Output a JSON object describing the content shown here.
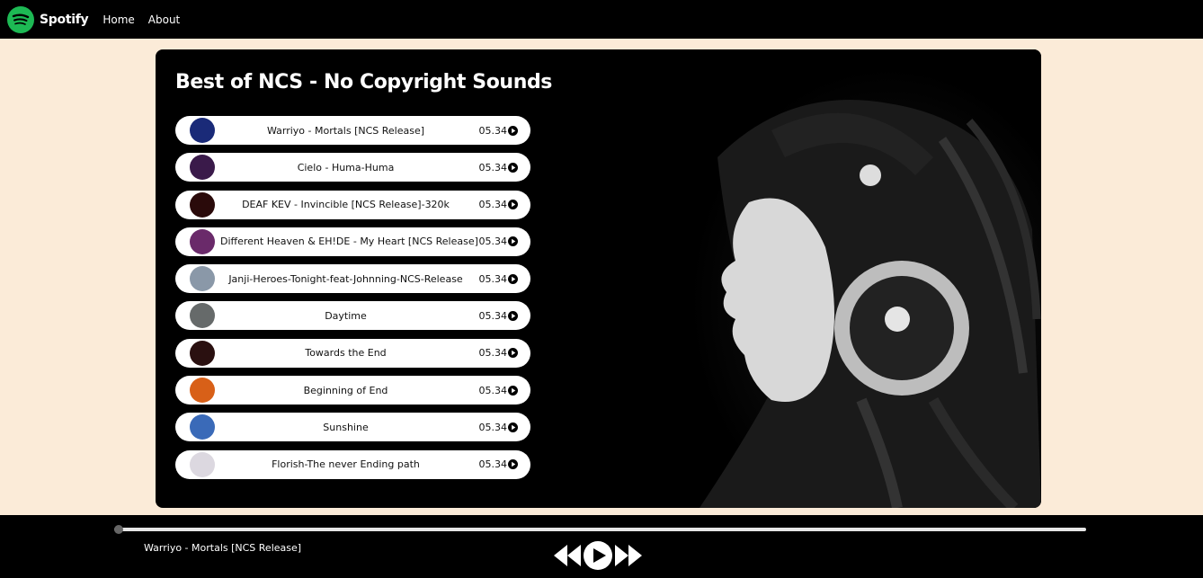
{
  "nav": {
    "brand": "Spotify",
    "links": [
      "Home",
      "About"
    ],
    "brand_color": "#1DB954"
  },
  "playlist": {
    "title": "Best of NCS - No Copyright Sounds",
    "songs": [
      {
        "name": "Warriyo - Mortals [NCS Release]",
        "duration": "05.34",
        "cover_color": "#1a2a78"
      },
      {
        "name": "Cielo - Huma-Huma",
        "duration": "05.34",
        "cover_color": "#3a1a4a"
      },
      {
        "name": "DEAF KEV - Invincible [NCS Release]-320k",
        "duration": "05.34",
        "cover_color": "#2a0a0a"
      },
      {
        "name": "Different Heaven & EH!DE - My Heart [NCS Release]",
        "duration": "05.34",
        "cover_color": "#6a2a6a"
      },
      {
        "name": "Janji-Heroes-Tonight-feat-Johnning-NCS-Release",
        "duration": "05.34",
        "cover_color": "#8a98a8"
      },
      {
        "name": "Daytime",
        "duration": "05.34",
        "cover_color": "#666a6a"
      },
      {
        "name": "Towards the End",
        "duration": "05.34",
        "cover_color": "#2a1010"
      },
      {
        "name": "Beginning of End",
        "duration": "05.34",
        "cover_color": "#d86018"
      },
      {
        "name": "Sunshine",
        "duration": "05.34",
        "cover_color": "#3a6ab8"
      },
      {
        "name": "Florish-The never Ending path",
        "duration": "05.34",
        "cover_color": "#dcd8e0"
      }
    ]
  },
  "player": {
    "now_playing": "Warriyo - Mortals [NCS Release]",
    "progress": 0
  },
  "icons": [
    "spotify-logo-icon",
    "play-circle-icon",
    "previous-icon",
    "play-icon",
    "next-icon"
  ]
}
